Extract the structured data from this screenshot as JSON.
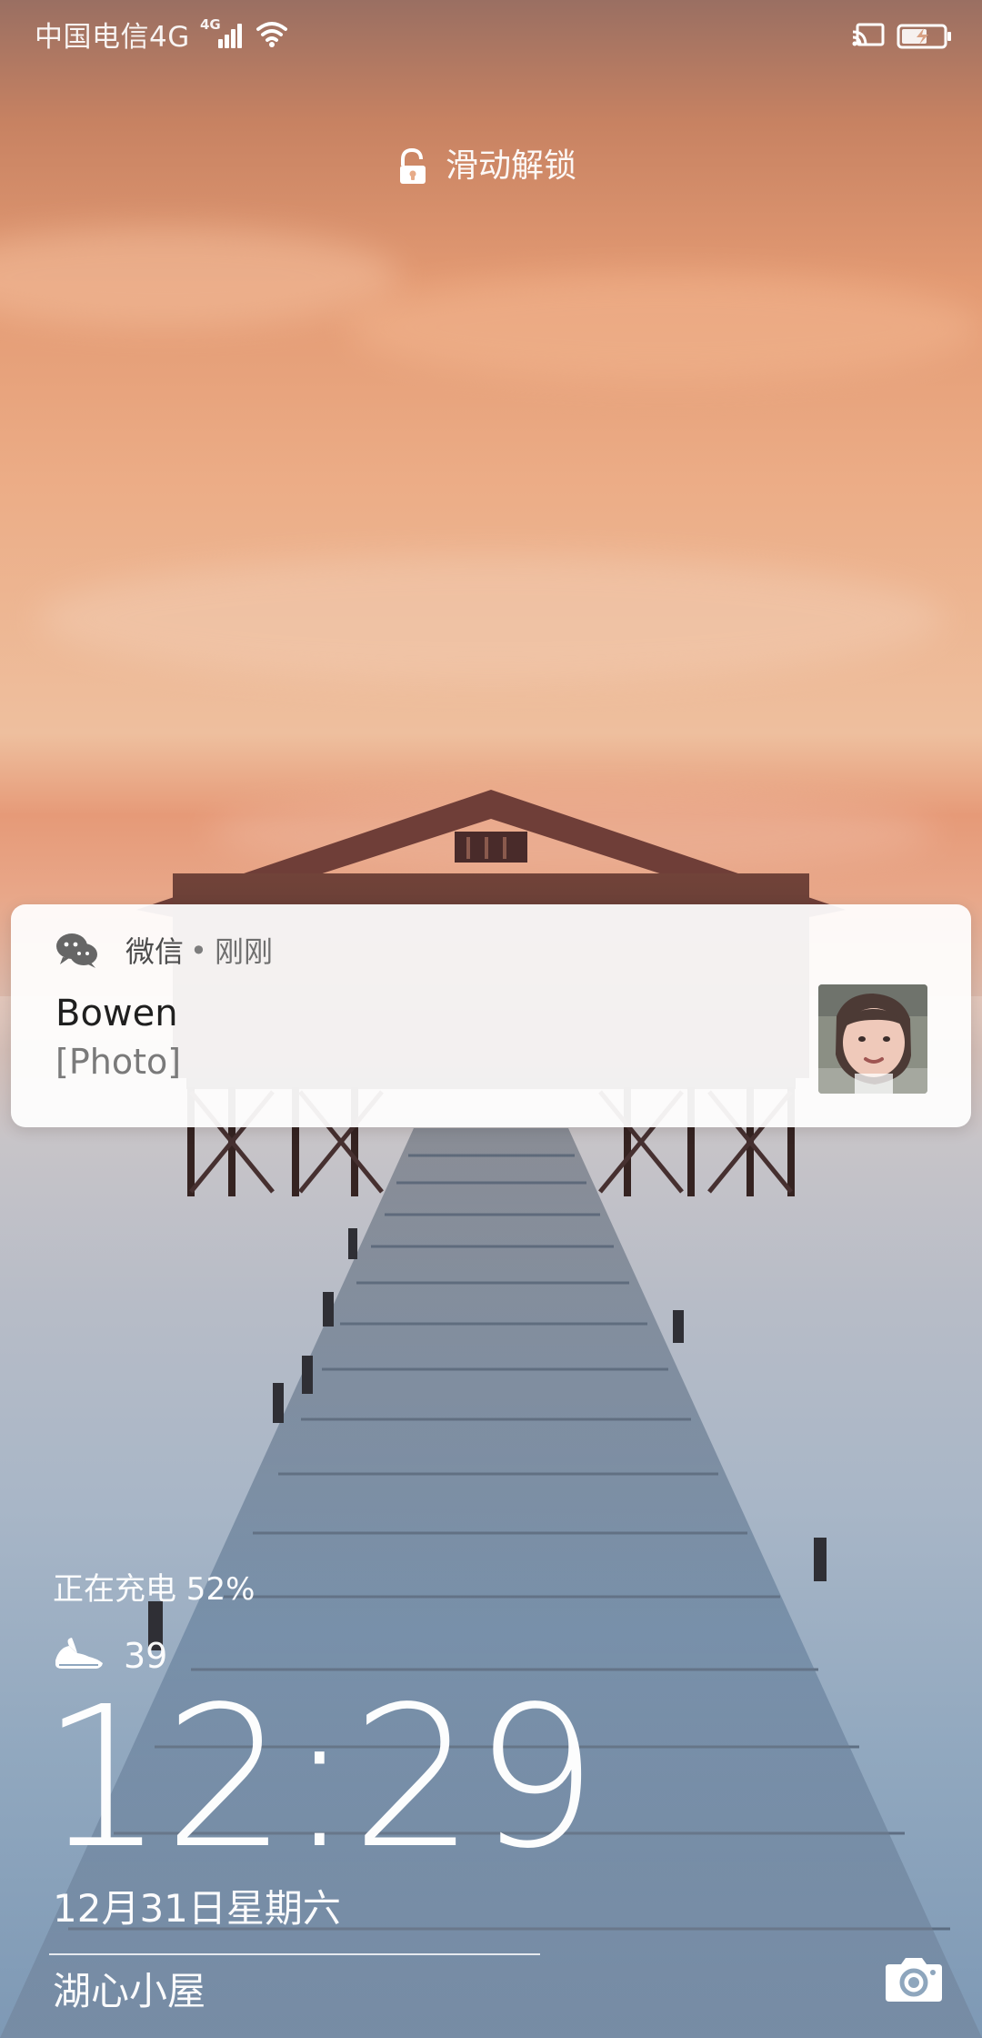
{
  "status_bar": {
    "carrier": "中国电信4G",
    "network_badge": "4G",
    "icons": [
      "signal-icon",
      "wifi-icon",
      "cast-icon",
      "battery-icon"
    ]
  },
  "lock_hint": {
    "text": "滑动解锁",
    "icon": "lock-icon"
  },
  "notification": {
    "app": "微信",
    "separator": "•",
    "time": "刚刚",
    "title": "Bowen",
    "body": "[Photo]",
    "icons": [
      "wechat-icon",
      "photo-thumbnail"
    ]
  },
  "lock_screen": {
    "charging": "正在充电 52%",
    "steps": "39",
    "time": "12:29",
    "date": "12月31日星期六",
    "location": "湖心小屋",
    "icons": [
      "shoe-icon",
      "camera-icon"
    ]
  },
  "colors": {
    "notification_background": "#ffffff",
    "text_primary": "#1f1f1f",
    "text_secondary": "#7a7a7a"
  }
}
